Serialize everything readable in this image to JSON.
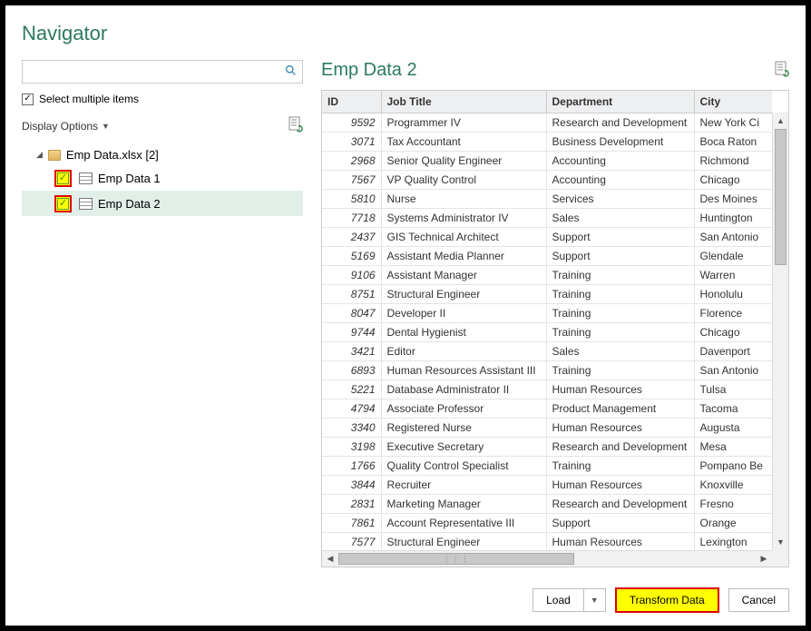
{
  "title": "Navigator",
  "search": {
    "placeholder": "",
    "icon": "search-icon"
  },
  "select_multiple_label": "Select multiple items",
  "display_options_label": "Display Options",
  "tree": {
    "root_label": "Emp Data.xlsx [2]",
    "items": [
      {
        "label": "Emp Data 1",
        "checked": true
      },
      {
        "label": "Emp Data 2",
        "checked": true,
        "selected": true
      }
    ]
  },
  "preview": {
    "title": "Emp Data 2",
    "columns": [
      "ID",
      "Job Title",
      "Department",
      "City"
    ],
    "rows": [
      {
        "id": "9592",
        "job": "Programmer IV",
        "dept": "Research and Development",
        "city": "New York Ci"
      },
      {
        "id": "3071",
        "job": "Tax Accountant",
        "dept": "Business Development",
        "city": "Boca Raton"
      },
      {
        "id": "2968",
        "job": "Senior Quality Engineer",
        "dept": "Accounting",
        "city": "Richmond"
      },
      {
        "id": "7567",
        "job": "VP Quality Control",
        "dept": "Accounting",
        "city": "Chicago"
      },
      {
        "id": "5810",
        "job": "Nurse",
        "dept": "Services",
        "city": "Des Moines"
      },
      {
        "id": "7718",
        "job": "Systems Administrator IV",
        "dept": "Sales",
        "city": "Huntington"
      },
      {
        "id": "2437",
        "job": "GIS Technical Architect",
        "dept": "Support",
        "city": "San Antonio"
      },
      {
        "id": "5169",
        "job": "Assistant Media Planner",
        "dept": "Support",
        "city": "Glendale"
      },
      {
        "id": "9106",
        "job": "Assistant Manager",
        "dept": "Training",
        "city": "Warren"
      },
      {
        "id": "8751",
        "job": "Structural Engineer",
        "dept": "Training",
        "city": "Honolulu"
      },
      {
        "id": "8047",
        "job": "Developer II",
        "dept": "Training",
        "city": "Florence"
      },
      {
        "id": "9744",
        "job": "Dental Hygienist",
        "dept": "Training",
        "city": "Chicago"
      },
      {
        "id": "3421",
        "job": "Editor",
        "dept": "Sales",
        "city": "Davenport"
      },
      {
        "id": "6893",
        "job": "Human Resources Assistant III",
        "dept": "Training",
        "city": "San Antonio"
      },
      {
        "id": "5221",
        "job": "Database Administrator II",
        "dept": "Human Resources",
        "city": "Tulsa"
      },
      {
        "id": "4794",
        "job": "Associate Professor",
        "dept": "Product Management",
        "city": "Tacoma"
      },
      {
        "id": "3340",
        "job": "Registered Nurse",
        "dept": "Human Resources",
        "city": "Augusta"
      },
      {
        "id": "3198",
        "job": "Executive Secretary",
        "dept": "Research and Development",
        "city": "Mesa"
      },
      {
        "id": "1766",
        "job": "Quality Control Specialist",
        "dept": "Training",
        "city": "Pompano Be"
      },
      {
        "id": "3844",
        "job": "Recruiter",
        "dept": "Human Resources",
        "city": "Knoxville"
      },
      {
        "id": "2831",
        "job": "Marketing Manager",
        "dept": "Research and Development",
        "city": "Fresno"
      },
      {
        "id": "7861",
        "job": "Account Representative III",
        "dept": "Support",
        "city": "Orange"
      },
      {
        "id": "7577",
        "job": "Structural Engineer",
        "dept": "Human Resources",
        "city": "Lexington"
      }
    ]
  },
  "buttons": {
    "load": "Load",
    "transform": "Transform Data",
    "cancel": "Cancel"
  }
}
